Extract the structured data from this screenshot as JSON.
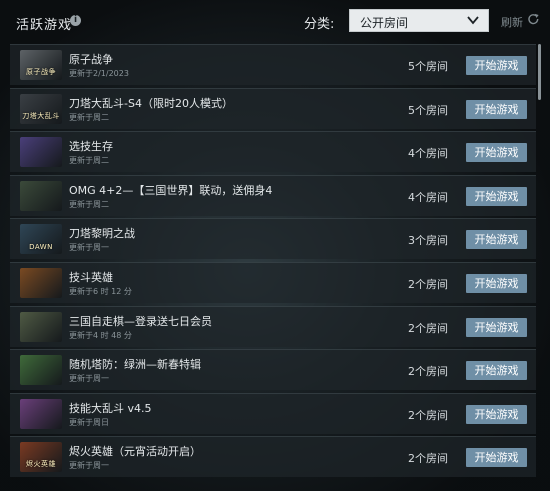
{
  "header": {
    "title": "活跃游戏",
    "info_icon": "info-icon",
    "filter_label": "分类:",
    "filter_selected": "公开房间",
    "refresh_label": "刷新"
  },
  "games": [
    {
      "name": "原子战争",
      "updated": "更新于2/1/2023",
      "rooms": "5个房间",
      "action": "开始游戏",
      "thumb_text": "原子战争",
      "thumb_color": "#5d6266"
    },
    {
      "name": "刀塔大乱斗-S4（限时20人模式）",
      "updated": "更新于周二",
      "rooms": "5个房间",
      "action": "开始游戏",
      "thumb_text": "刀塔大乱斗",
      "thumb_color": "#3a3f44"
    },
    {
      "name": "选技生存",
      "updated": "更新于周二",
      "rooms": "4个房间",
      "action": "开始游戏",
      "thumb_text": "",
      "thumb_color": "#4a3f7a"
    },
    {
      "name": "OMG 4+2—【三国世界】联动，送佣身4",
      "updated": "更新于周二",
      "rooms": "4个房间",
      "action": "开始游戏",
      "thumb_text": "",
      "thumb_color": "#3b4a3a"
    },
    {
      "name": "刀塔黎明之战",
      "updated": "更新于周一",
      "rooms": "3个房间",
      "action": "开始游戏",
      "thumb_text": "DAWN",
      "thumb_color": "#2f4656"
    },
    {
      "name": "技斗英雄",
      "updated": "更新于6 时 12 分",
      "rooms": "2个房间",
      "action": "开始游戏",
      "thumb_text": "",
      "thumb_color": "#7a4a22"
    },
    {
      "name": "三国自走棋—登录送七日会员",
      "updated": "更新于4 时 48 分",
      "rooms": "2个房间",
      "action": "开始游戏",
      "thumb_text": "",
      "thumb_color": "#4f5a44"
    },
    {
      "name": "随机塔防：绿洲—新春特辑",
      "updated": "更新于周一",
      "rooms": "2个房间",
      "action": "开始游戏",
      "thumb_text": "",
      "thumb_color": "#3f6a3a"
    },
    {
      "name": "技能大乱斗 v4.5",
      "updated": "更新于周日",
      "rooms": "2个房间",
      "action": "开始游戏",
      "thumb_text": "",
      "thumb_color": "#6a3f7a"
    },
    {
      "name": "烬火英雄（元宵活动开启）",
      "updated": "更新于周一",
      "rooms": "2个房间",
      "action": "开始游戏",
      "thumb_text": "烬火英雄",
      "thumb_color": "#7a3a22"
    }
  ]
}
